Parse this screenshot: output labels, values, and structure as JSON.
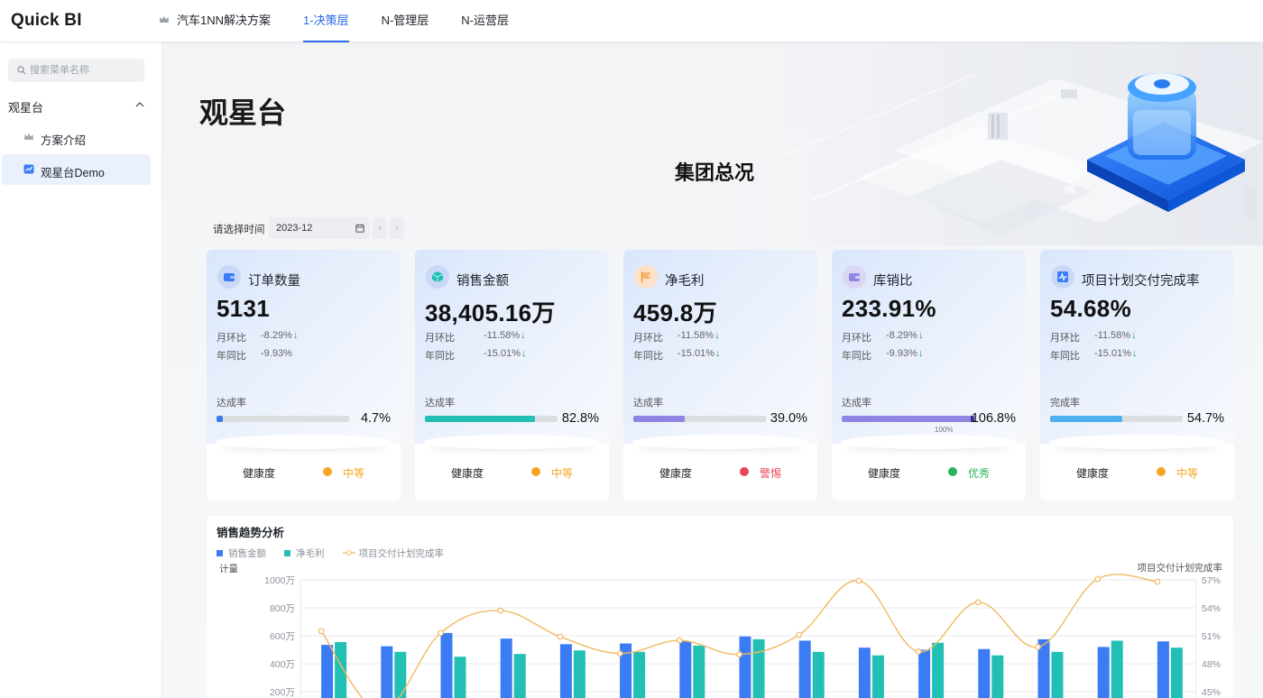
{
  "app": {
    "logo": "Quick BI"
  },
  "nav": {
    "tabs": [
      {
        "label": "汽车1NN解决方案",
        "active": false
      },
      {
        "label": "1-决策层",
        "active": true
      },
      {
        "label": "N-管理层",
        "active": false
      },
      {
        "label": "N-运营层",
        "active": false
      }
    ]
  },
  "sidebar": {
    "search_placeholder": "搜索菜单名称",
    "group_label": "观星台",
    "items": [
      {
        "label": "方案介绍",
        "icon": "crown-icon",
        "selected": false
      },
      {
        "label": "观星台Demo",
        "icon": "chart-icon",
        "selected": true
      }
    ]
  },
  "page": {
    "title": "观星台",
    "section_title": "集团总况",
    "date_label": "请选择时间",
    "date_value": "2023-12",
    "prev_label": "‹",
    "next_label": "›"
  },
  "colors": {
    "accent": "#2a6ae9",
    "good": "#2bb35a",
    "medium": "#f5a623",
    "warn": "#e8465a"
  },
  "kpis": [
    {
      "name": "订单数量",
      "icon": "wallet-icon",
      "value": "5131",
      "mom_label": "月环比",
      "mom": "-8.29%",
      "yoy_label": "年同比",
      "yoy": "-9.93%",
      "yoy_arrow": false,
      "rate_label": "达成率",
      "rate": 0.047,
      "rate_text": "4.7%",
      "bar_color": "#3b7cf5",
      "health_label": "健康度",
      "health": "中等",
      "health_color": "#f5a623"
    },
    {
      "name": "销售金额",
      "icon": "cube-icon",
      "value": "38,405.16万",
      "mom_label": "月环比",
      "mom": "-11.58%",
      "yoy_label": "年同比",
      "yoy": "-15.01%",
      "yoy_arrow": true,
      "rate_label": "达成率",
      "rate": 0.828,
      "rate_text": "82.8%",
      "bar_color": "#22c0b4",
      "health_label": "健康度",
      "health": "中等",
      "health_color": "#f5a623"
    },
    {
      "name": "净毛利",
      "icon": "flag-icon",
      "value": "459.8万",
      "mom_label": "月环比",
      "mom": "-11.58%",
      "yoy_label": "年同比",
      "yoy": "-15.01%",
      "yoy_arrow": true,
      "rate_label": "达成率",
      "rate": 0.39,
      "rate_text": "39.0%",
      "bar_color": "#8f85e3",
      "health_label": "健康度",
      "health": "警惕",
      "health_color": "#e8465a"
    },
    {
      "name": "库销比",
      "icon": "wallet-icon",
      "value": "233.91%",
      "mom_label": "月环比",
      "mom": "-8.29%",
      "yoy_label": "年同比",
      "yoy": "-9.93%",
      "yoy_arrow": true,
      "rate_label": "达成率",
      "rate": 1.0,
      "rate_text": "106.8%",
      "bar_color": "#8f85e3",
      "tick_label": "100%",
      "health_label": "健康度",
      "health": "优秀",
      "health_color": "#2bb35a"
    },
    {
      "name": "项目计划交付完成率",
      "icon": "pulse-icon",
      "value": "54.68%",
      "mom_label": "月环比",
      "mom": "-11.58%",
      "yoy_label": "年同比",
      "yoy": "-15.01%",
      "yoy_arrow": true,
      "rate_label": "完成率",
      "rate": 0.547,
      "rate_text": "54.7%",
      "bar_color": "#4fb1ee",
      "health_label": "健康度",
      "health": "中等",
      "health_color": "#f5a623"
    }
  ],
  "chart_data": {
    "type": "bar",
    "title": "销售趋势分析",
    "ylabel": "计量",
    "y2label": "项目交付计划完成率",
    "yticks": [
      "1000万",
      "800万",
      "600万",
      "400万",
      "200万"
    ],
    "y2ticks": [
      "57%",
      "54%",
      "51%",
      "48%",
      "45%"
    ],
    "ylim": [
      0,
      1000
    ],
    "y2lim": [
      42,
      57
    ],
    "series": [
      {
        "name": "销售金额",
        "type": "bar",
        "color": "#3b7cf5",
        "values": [
          535,
          525,
          620,
          580,
          540,
          545,
          560,
          595,
          565,
          515,
          500,
          505,
          575,
          520,
          560
        ]
      },
      {
        "name": "净毛利",
        "type": "bar",
        "color": "#22c0b4",
        "values": [
          555,
          485,
          450,
          470,
          495,
          485,
          530,
          575,
          485,
          460,
          550,
          460,
          485,
          565,
          515
        ]
      },
      {
        "name": "项目交付计划完成率",
        "type": "line",
        "color": "#f2b960",
        "axis": "right",
        "values": [
          51.5,
          43.0,
          51.3,
          53.7,
          50.9,
          49.1,
          50.5,
          49.0,
          51.1,
          56.9,
          49.3,
          54.6,
          49.8,
          57.1,
          56.8
        ]
      }
    ]
  }
}
